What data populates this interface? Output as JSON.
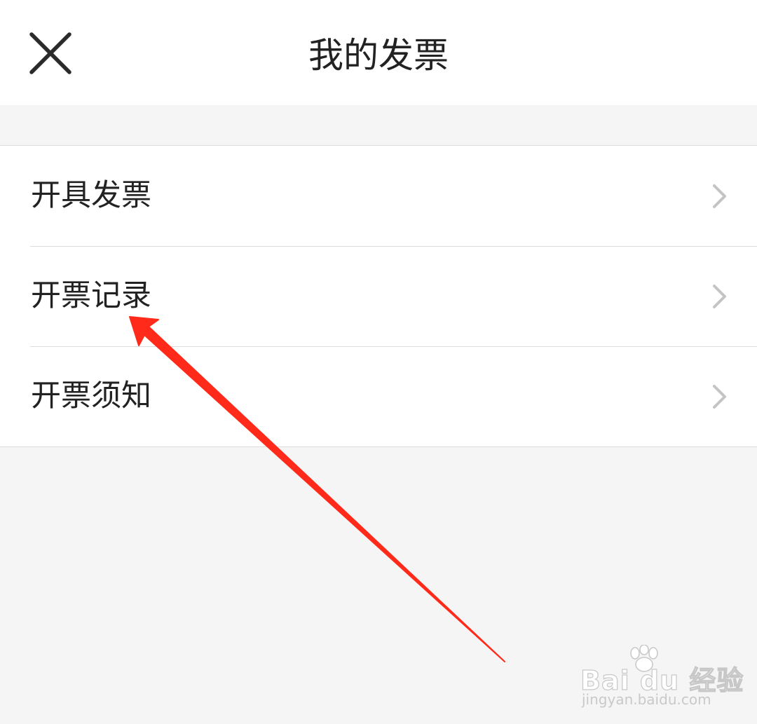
{
  "header": {
    "title": "我的发票",
    "close_icon": "close-icon"
  },
  "menu": {
    "items": [
      {
        "label": "开具发票",
        "icon": "chevron-right-icon"
      },
      {
        "label": "开票记录",
        "icon": "chevron-right-icon"
      },
      {
        "label": "开票须知",
        "icon": "chevron-right-icon"
      }
    ]
  },
  "annotation": {
    "arrow_color": "#ff2a1a",
    "target": "开票记录"
  },
  "watermark": {
    "brand": "Bai du 经验",
    "url": "jingyan.baidu.com"
  },
  "colors": {
    "background": "#f5f5f5",
    "surface": "#ffffff",
    "divider": "#dcdcdc",
    "text": "#222222",
    "chevron": "#c4c4c4"
  }
}
